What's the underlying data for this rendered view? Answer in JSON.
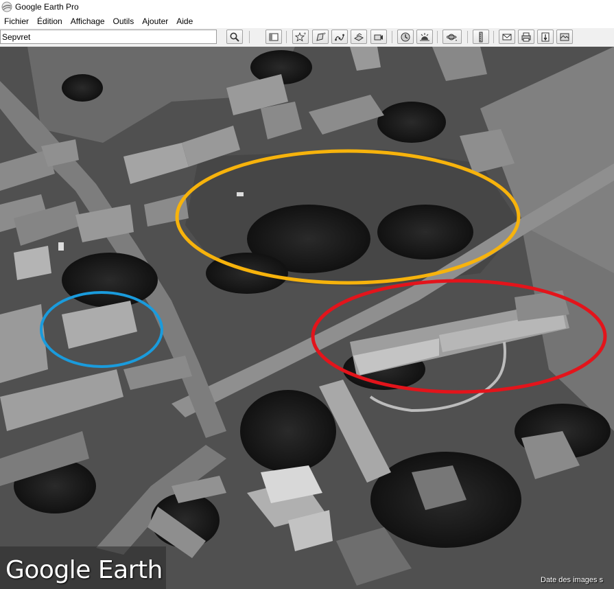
{
  "window": {
    "title": "Google Earth Pro"
  },
  "menu": {
    "items": [
      "Fichier",
      "Édition",
      "Affichage",
      "Outils",
      "Ajouter",
      "Aide"
    ]
  },
  "search": {
    "value": "Sepvret"
  },
  "toolbar": {
    "icons": [
      "search-icon",
      "sidebar-icon",
      "placemark-icon",
      "polygon-icon",
      "path-icon",
      "image-overlay-icon",
      "record-tour-icon",
      "historical-imagery-icon",
      "sunlight-icon",
      "planets-icon",
      "ruler-icon",
      "email-icon",
      "print-icon",
      "save-image-icon",
      "maps-icon"
    ]
  },
  "map": {
    "logo": "Google Earth",
    "attribution": "Date des images s",
    "annotation_colors": {
      "yellow": "#f7b30c",
      "red": "#e3141b",
      "blue": "#1a9bdc"
    }
  }
}
